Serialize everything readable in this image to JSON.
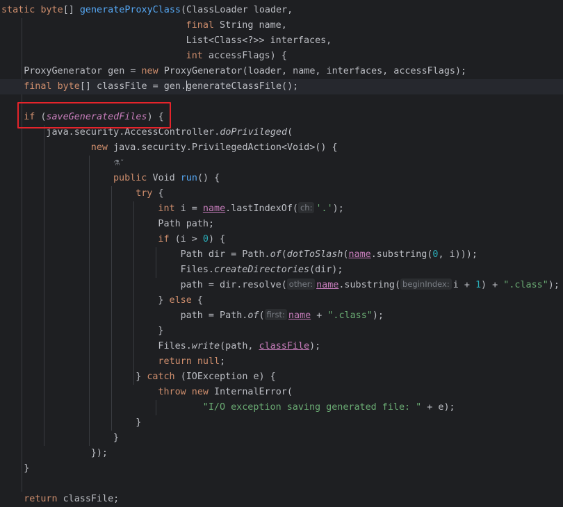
{
  "editor": {
    "highlight_color": "#e5242b",
    "lens_icon": "ai-assistant-icon",
    "lines": [
      {
        "indent": 0,
        "tokens": [
          {
            "t": "static ",
            "c": "kw"
          },
          {
            "t": "byte",
            "c": "kw"
          },
          {
            "t": "[] "
          },
          {
            "t": "generateProxyClass",
            "c": "fn"
          },
          {
            "t": "(ClassLoader loader,"
          }
        ]
      },
      {
        "indent": 33,
        "tokens": [
          {
            "t": "final ",
            "c": "kw"
          },
          {
            "t": "String name,"
          }
        ]
      },
      {
        "indent": 33,
        "tokens": [
          {
            "t": "List<Class<?>> interfaces,"
          }
        ]
      },
      {
        "indent": 33,
        "tokens": [
          {
            "t": "int ",
            "c": "kw"
          },
          {
            "t": "accessFlags) {"
          }
        ]
      },
      {
        "indent": 4,
        "tokens": [
          {
            "t": "ProxyGenerator gen = "
          },
          {
            "t": "new ",
            "c": "kw"
          },
          {
            "t": "ProxyGenerator(loader, name, interfaces, accessFlags);"
          }
        ]
      },
      {
        "indent": 4,
        "current": true,
        "tokens": [
          {
            "t": "final ",
            "c": "kw"
          },
          {
            "t": "byte",
            "c": "kw"
          },
          {
            "t": "[] classFile = gen."
          },
          {
            "caret": true
          },
          {
            "t": "generateClassFile();"
          }
        ]
      },
      {
        "indent": 0,
        "tokens": []
      },
      {
        "indent": 4,
        "tokens": [
          {
            "t": "if ",
            "c": "kw"
          },
          {
            "t": "("
          },
          {
            "t": "saveGeneratedFiles",
            "c": "fldi"
          },
          {
            "t": ") {"
          }
        ]
      },
      {
        "indent": 8,
        "tokens": [
          {
            "t": "java.security.AccessController."
          },
          {
            "t": "doPrivileged",
            "c": "it"
          },
          {
            "t": "("
          }
        ]
      },
      {
        "indent": 16,
        "tokens": [
          {
            "t": "new ",
            "c": "kw"
          },
          {
            "t": "java.security.PrivilegedAction<Void>() {"
          }
        ]
      },
      {
        "indent": 20,
        "lens": true,
        "tokens": [
          {
            "t": "⚗˅",
            "c": "lens"
          }
        ]
      },
      {
        "indent": 20,
        "tokens": [
          {
            "t": "public ",
            "c": "kw"
          },
          {
            "t": "Void "
          },
          {
            "t": "run",
            "c": "fn"
          },
          {
            "t": "() {"
          }
        ]
      },
      {
        "indent": 24,
        "tokens": [
          {
            "t": "try ",
            "c": "kw"
          },
          {
            "t": "{"
          }
        ]
      },
      {
        "indent": 28,
        "tokens": [
          {
            "t": "int ",
            "c": "kw"
          },
          {
            "t": "i = "
          },
          {
            "t": "name",
            "c": "fld ul"
          },
          {
            "t": ".lastIndexOf("
          },
          {
            "hint": "ch:"
          },
          {
            "t": "'.'",
            "c": "str"
          },
          {
            "t": ");"
          }
        ]
      },
      {
        "indent": 28,
        "tokens": [
          {
            "t": "Path path;"
          }
        ]
      },
      {
        "indent": 28,
        "tokens": [
          {
            "t": "if ",
            "c": "kw"
          },
          {
            "t": "(i > "
          },
          {
            "t": "0",
            "c": "num"
          },
          {
            "t": ") {"
          }
        ]
      },
      {
        "indent": 32,
        "tokens": [
          {
            "t": "Path dir = Path."
          },
          {
            "t": "of",
            "c": "it"
          },
          {
            "t": "("
          },
          {
            "t": "dotToSlash",
            "c": "it"
          },
          {
            "t": "("
          },
          {
            "t": "name",
            "c": "fld ul"
          },
          {
            "t": ".substring("
          },
          {
            "t": "0",
            "c": "num"
          },
          {
            "t": ", i)));"
          }
        ]
      },
      {
        "indent": 32,
        "tokens": [
          {
            "t": "Files."
          },
          {
            "t": "createDirectories",
            "c": "it"
          },
          {
            "t": "(dir);"
          }
        ]
      },
      {
        "indent": 32,
        "tokens": [
          {
            "t": "path = dir.resolve("
          },
          {
            "hint": "other:"
          },
          {
            "t": "name",
            "c": "fld ul"
          },
          {
            "t": ".substring("
          },
          {
            "hint": "beginIndex:"
          },
          {
            "t": "i + "
          },
          {
            "t": "1",
            "c": "num"
          },
          {
            "t": ") + "
          },
          {
            "t": "\".class\"",
            "c": "str"
          },
          {
            "t": ");"
          }
        ]
      },
      {
        "indent": 28,
        "tokens": [
          {
            "t": "} "
          },
          {
            "t": "else ",
            "c": "kw"
          },
          {
            "t": "{"
          }
        ]
      },
      {
        "indent": 32,
        "tokens": [
          {
            "t": "path = Path."
          },
          {
            "t": "of",
            "c": "it"
          },
          {
            "t": "("
          },
          {
            "hint": "first:"
          },
          {
            "t": "name",
            "c": "fld ul"
          },
          {
            "t": " + "
          },
          {
            "t": "\".class\"",
            "c": "str"
          },
          {
            "t": ");"
          }
        ]
      },
      {
        "indent": 28,
        "tokens": [
          {
            "t": "}"
          }
        ]
      },
      {
        "indent": 28,
        "tokens": [
          {
            "t": "Files."
          },
          {
            "t": "write",
            "c": "it"
          },
          {
            "t": "(path, "
          },
          {
            "t": "classFile",
            "c": "fld ul"
          },
          {
            "t": ");"
          }
        ]
      },
      {
        "indent": 28,
        "tokens": [
          {
            "t": "return ",
            "c": "kw"
          },
          {
            "t": "null",
            "c": "kw"
          },
          {
            "t": ";"
          }
        ]
      },
      {
        "indent": 24,
        "tokens": [
          {
            "t": "} "
          },
          {
            "t": "catch ",
            "c": "kw"
          },
          {
            "t": "(IOException e) {"
          }
        ]
      },
      {
        "indent": 28,
        "tokens": [
          {
            "t": "throw ",
            "c": "kw"
          },
          {
            "t": "new ",
            "c": "kw"
          },
          {
            "t": "InternalError("
          }
        ]
      },
      {
        "indent": 36,
        "tokens": [
          {
            "t": "\"I/O exception saving generated file: \"",
            "c": "str"
          },
          {
            "t": " + e);"
          }
        ]
      },
      {
        "indent": 24,
        "tokens": [
          {
            "t": "}"
          }
        ]
      },
      {
        "indent": 20,
        "tokens": [
          {
            "t": "}"
          }
        ]
      },
      {
        "indent": 16,
        "tokens": [
          {
            "t": "});"
          }
        ]
      },
      {
        "indent": 4,
        "tokens": [
          {
            "t": "}"
          }
        ]
      },
      {
        "indent": 0,
        "tokens": []
      },
      {
        "indent": 4,
        "tokens": [
          {
            "t": "return ",
            "c": "kw"
          },
          {
            "t": "classFile;"
          }
        ]
      }
    ]
  }
}
